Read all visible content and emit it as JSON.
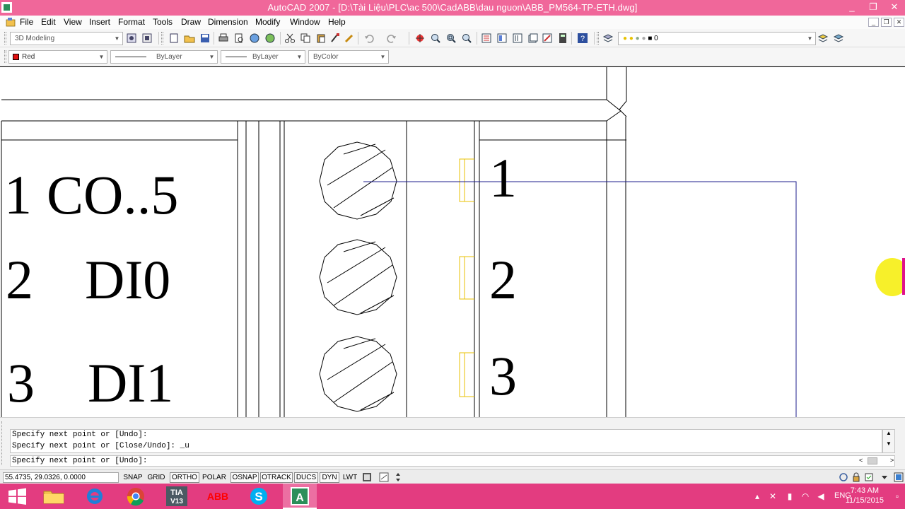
{
  "window": {
    "title": "AutoCAD 2007 - [D:\\Tài Liệu\\PLC\\ac 500\\CadABB\\dau nguon\\ABB_PM564-TP-ETH.dwg]",
    "controls": {
      "minimize": "_",
      "restore": "❐",
      "close": "✕"
    }
  },
  "menubar": {
    "items": [
      "File",
      "Edit",
      "View",
      "Insert",
      "Format",
      "Tools",
      "Draw",
      "Dimension",
      "Modify",
      "Window",
      "Help"
    ],
    "mdi": {
      "minimize": "_",
      "restore": "❐",
      "close": "✕"
    }
  },
  "toolbar1": {
    "workspace": "3D Modeling",
    "layer": "0"
  },
  "toolbar2": {
    "color": {
      "label": "Red",
      "swatch": "#e01010"
    },
    "linetype": "ByLayer",
    "lineweight": "ByLayer",
    "plotstyle": "ByColor"
  },
  "drawing": {
    "left_labels": [
      {
        "num": "1",
        "name": "CO..5"
      },
      {
        "num": "2",
        "name": "DI0"
      },
      {
        "num": "3",
        "name": "DI1"
      }
    ],
    "right_labels": [
      "1",
      "2",
      "3"
    ],
    "colors": {
      "line": "#000000",
      "terminal": "#e8c200",
      "polyline": "#1c1c8c",
      "cursor": "#f7f02a",
      "cursor_mark": "#e0128a"
    }
  },
  "command": {
    "history": [
      "Specify next point or [Undo]:",
      "Specify next point or [Close/Undo]: _u"
    ],
    "prompt": "Specify next point or [Undo]:",
    "scroll_up": "▲",
    "scroll_down": "▼",
    "hscroll_left": "<",
    "hscroll_right": ">"
  },
  "statusbar": {
    "coords": "55.4735, 29.0326, 0.0000",
    "buttons": [
      "SNAP",
      "GRID",
      "ORTHO",
      "POLAR",
      "OSNAP",
      "OTRACK",
      "DUCS",
      "DYN",
      "LWT"
    ]
  },
  "taskbar": {
    "apps": [
      "start",
      "file-explorer",
      "internet-explorer",
      "chrome",
      "tia-v13",
      "abb",
      "skype",
      "autocad"
    ],
    "tia_label": "TIA\nV13",
    "abb_label": "ABB",
    "lang": "ENG",
    "time": "7:43 AM",
    "date": "11/15/2015"
  }
}
